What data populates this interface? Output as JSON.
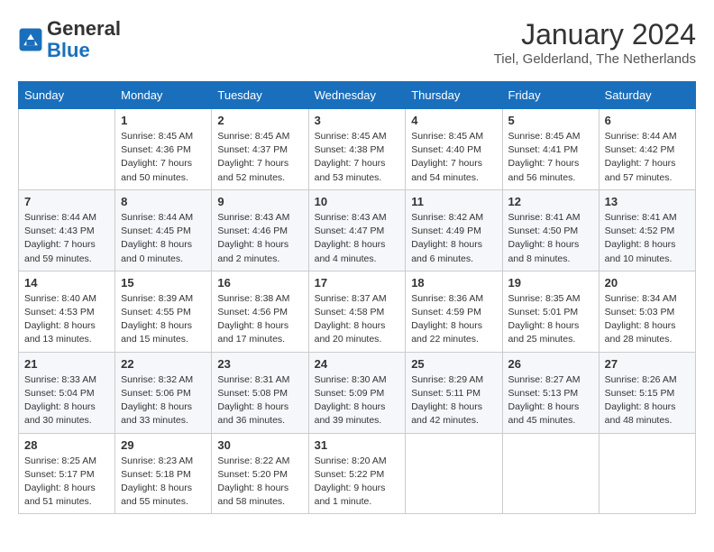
{
  "header": {
    "logo_text_general": "General",
    "logo_text_blue": "Blue",
    "month": "January 2024",
    "location": "Tiel, Gelderland, The Netherlands"
  },
  "weekdays": [
    "Sunday",
    "Monday",
    "Tuesday",
    "Wednesday",
    "Thursday",
    "Friday",
    "Saturday"
  ],
  "weeks": [
    [
      {
        "day": "",
        "info": ""
      },
      {
        "day": "1",
        "info": "Sunrise: 8:45 AM\nSunset: 4:36 PM\nDaylight: 7 hours\nand 50 minutes."
      },
      {
        "day": "2",
        "info": "Sunrise: 8:45 AM\nSunset: 4:37 PM\nDaylight: 7 hours\nand 52 minutes."
      },
      {
        "day": "3",
        "info": "Sunrise: 8:45 AM\nSunset: 4:38 PM\nDaylight: 7 hours\nand 53 minutes."
      },
      {
        "day": "4",
        "info": "Sunrise: 8:45 AM\nSunset: 4:40 PM\nDaylight: 7 hours\nand 54 minutes."
      },
      {
        "day": "5",
        "info": "Sunrise: 8:45 AM\nSunset: 4:41 PM\nDaylight: 7 hours\nand 56 minutes."
      },
      {
        "day": "6",
        "info": "Sunrise: 8:44 AM\nSunset: 4:42 PM\nDaylight: 7 hours\nand 57 minutes."
      }
    ],
    [
      {
        "day": "7",
        "info": "Sunrise: 8:44 AM\nSunset: 4:43 PM\nDaylight: 7 hours\nand 59 minutes."
      },
      {
        "day": "8",
        "info": "Sunrise: 8:44 AM\nSunset: 4:45 PM\nDaylight: 8 hours\nand 0 minutes."
      },
      {
        "day": "9",
        "info": "Sunrise: 8:43 AM\nSunset: 4:46 PM\nDaylight: 8 hours\nand 2 minutes."
      },
      {
        "day": "10",
        "info": "Sunrise: 8:43 AM\nSunset: 4:47 PM\nDaylight: 8 hours\nand 4 minutes."
      },
      {
        "day": "11",
        "info": "Sunrise: 8:42 AM\nSunset: 4:49 PM\nDaylight: 8 hours\nand 6 minutes."
      },
      {
        "day": "12",
        "info": "Sunrise: 8:41 AM\nSunset: 4:50 PM\nDaylight: 8 hours\nand 8 minutes."
      },
      {
        "day": "13",
        "info": "Sunrise: 8:41 AM\nSunset: 4:52 PM\nDaylight: 8 hours\nand 10 minutes."
      }
    ],
    [
      {
        "day": "14",
        "info": "Sunrise: 8:40 AM\nSunset: 4:53 PM\nDaylight: 8 hours\nand 13 minutes."
      },
      {
        "day": "15",
        "info": "Sunrise: 8:39 AM\nSunset: 4:55 PM\nDaylight: 8 hours\nand 15 minutes."
      },
      {
        "day": "16",
        "info": "Sunrise: 8:38 AM\nSunset: 4:56 PM\nDaylight: 8 hours\nand 17 minutes."
      },
      {
        "day": "17",
        "info": "Sunrise: 8:37 AM\nSunset: 4:58 PM\nDaylight: 8 hours\nand 20 minutes."
      },
      {
        "day": "18",
        "info": "Sunrise: 8:36 AM\nSunset: 4:59 PM\nDaylight: 8 hours\nand 22 minutes."
      },
      {
        "day": "19",
        "info": "Sunrise: 8:35 AM\nSunset: 5:01 PM\nDaylight: 8 hours\nand 25 minutes."
      },
      {
        "day": "20",
        "info": "Sunrise: 8:34 AM\nSunset: 5:03 PM\nDaylight: 8 hours\nand 28 minutes."
      }
    ],
    [
      {
        "day": "21",
        "info": "Sunrise: 8:33 AM\nSunset: 5:04 PM\nDaylight: 8 hours\nand 30 minutes."
      },
      {
        "day": "22",
        "info": "Sunrise: 8:32 AM\nSunset: 5:06 PM\nDaylight: 8 hours\nand 33 minutes."
      },
      {
        "day": "23",
        "info": "Sunrise: 8:31 AM\nSunset: 5:08 PM\nDaylight: 8 hours\nand 36 minutes."
      },
      {
        "day": "24",
        "info": "Sunrise: 8:30 AM\nSunset: 5:09 PM\nDaylight: 8 hours\nand 39 minutes."
      },
      {
        "day": "25",
        "info": "Sunrise: 8:29 AM\nSunset: 5:11 PM\nDaylight: 8 hours\nand 42 minutes."
      },
      {
        "day": "26",
        "info": "Sunrise: 8:27 AM\nSunset: 5:13 PM\nDaylight: 8 hours\nand 45 minutes."
      },
      {
        "day": "27",
        "info": "Sunrise: 8:26 AM\nSunset: 5:15 PM\nDaylight: 8 hours\nand 48 minutes."
      }
    ],
    [
      {
        "day": "28",
        "info": "Sunrise: 8:25 AM\nSunset: 5:17 PM\nDaylight: 8 hours\nand 51 minutes."
      },
      {
        "day": "29",
        "info": "Sunrise: 8:23 AM\nSunset: 5:18 PM\nDaylight: 8 hours\nand 55 minutes."
      },
      {
        "day": "30",
        "info": "Sunrise: 8:22 AM\nSunset: 5:20 PM\nDaylight: 8 hours\nand 58 minutes."
      },
      {
        "day": "31",
        "info": "Sunrise: 8:20 AM\nSunset: 5:22 PM\nDaylight: 9 hours\nand 1 minute."
      },
      {
        "day": "",
        "info": ""
      },
      {
        "day": "",
        "info": ""
      },
      {
        "day": "",
        "info": ""
      }
    ]
  ]
}
